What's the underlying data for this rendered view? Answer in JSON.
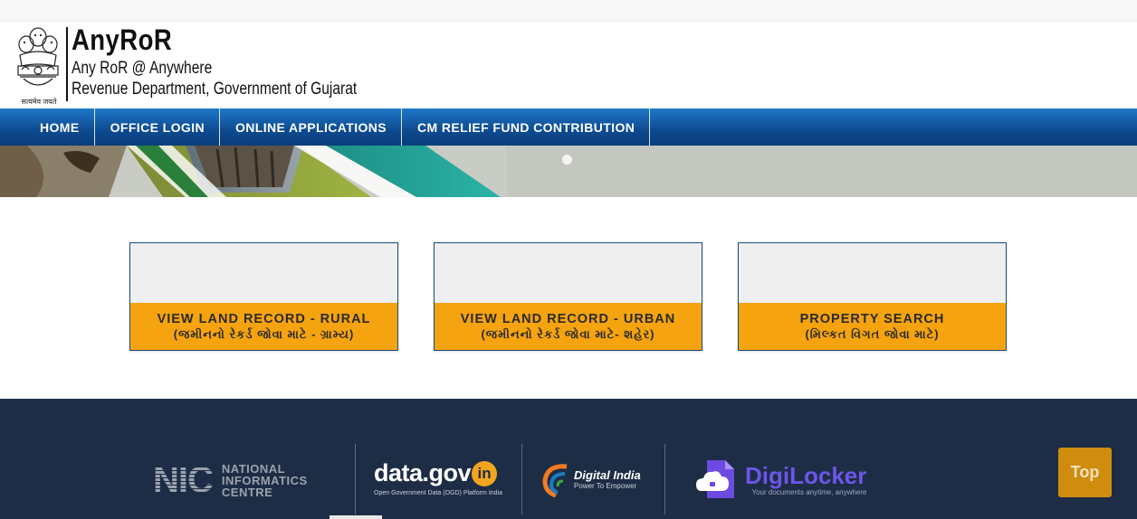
{
  "header": {
    "title": "AnyRoR",
    "subtitle": "Any RoR @ Anywhere",
    "department": "Revenue Department, Government of Gujarat",
    "emblem_caption": "सत्यमेव जयते"
  },
  "nav": {
    "items": [
      {
        "label": "HOME"
      },
      {
        "label": "OFFICE LOGIN"
      },
      {
        "label": "ONLINE APPLICATIONS"
      },
      {
        "label": "CM RELIEF FUND CONTRIBUTION"
      }
    ]
  },
  "cards": [
    {
      "title": "VIEW LAND RECORD - RURAL",
      "subtitle": "(જમીનનો રેકર્ડ જોવા માટે - ગ્રામ્ય)"
    },
    {
      "title": "VIEW LAND RECORD - URBAN",
      "subtitle": "(જમીનનો રેકર્ડ જોવા માટે- શહેર)"
    },
    {
      "title": "PROPERTY SEARCH",
      "subtitle": "(મિલ્કત વિગત જોવા માટે)"
    }
  ],
  "footer": {
    "nic": {
      "mark": "NIC",
      "line1": "NATIONAL",
      "line2": "INFORMATICS",
      "line3": "CENTRE"
    },
    "datagov": {
      "main": "data.gov",
      "badge": "in",
      "caption": "Open Government Data (OGD) Platform India"
    },
    "digital_india": {
      "main": "Digital India",
      "caption": "Power To Empower"
    },
    "digilocker": {
      "main": "DigiLocker",
      "caption": "Your documents anytime, anywhere"
    },
    "top_button": "Top"
  },
  "colors": {
    "nav_blue": "#0d4a8f",
    "card_caption": "#f5a30f",
    "footer_bg": "#1e2d46",
    "top_button": "#d08c0f"
  }
}
